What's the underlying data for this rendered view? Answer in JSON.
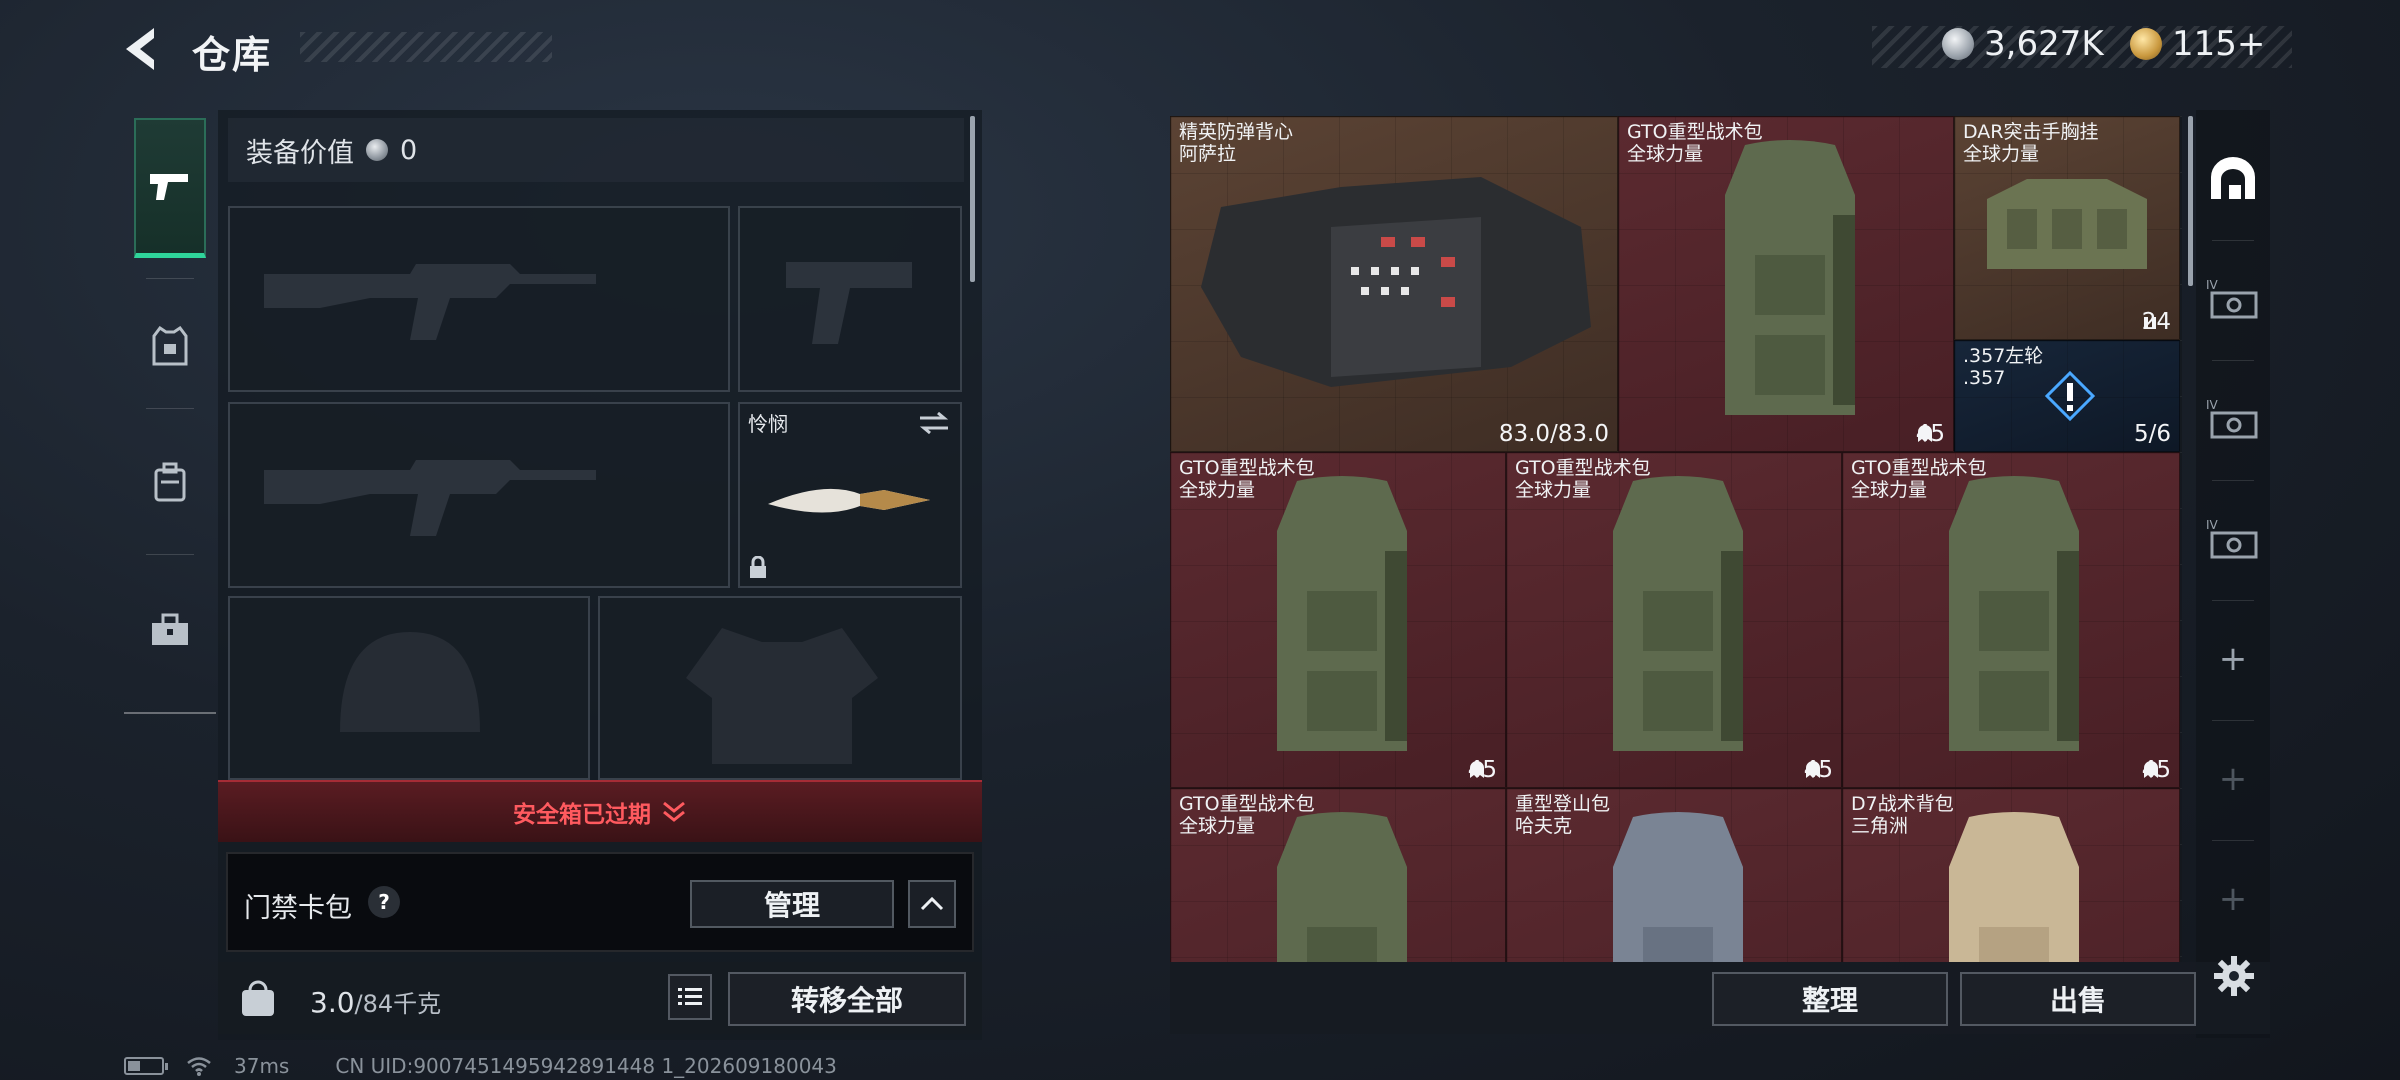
{
  "header": {
    "title": "仓库",
    "currency_silver": "3,627K",
    "currency_gold": "115+"
  },
  "left": {
    "value_label": "装备价值",
    "value_amount": "0",
    "melee_label": "怜悯",
    "expired_text": "安全箱已过期",
    "keycard_label": "门禁卡包",
    "help_label": "?",
    "manage_button": "管理",
    "weight_current": "3.0",
    "weight_max": "/84千克",
    "transfer_button": "转移全部"
  },
  "inventory": {
    "items": [
      {
        "name": "精英防弹背心",
        "sub": "阿萨拉",
        "stat": "83.0/83.0",
        "bg": "brown"
      },
      {
        "name": "GTO重型战术包",
        "sub": "全球力量",
        "stat": "45",
        "bg": "red"
      },
      {
        "name": "DAR突击手胸挂",
        "sub": "全球力量",
        "stat": "24",
        "bg": "brown"
      },
      {
        "name": ".357左轮",
        "sub": ".357",
        "stat": "5/6",
        "bg": "blue"
      },
      {
        "name": "GTO重型战术包",
        "sub": "全球力量",
        "stat": "45",
        "bg": "red"
      },
      {
        "name": "GTO重型战术包",
        "sub": "全球力量",
        "stat": "45",
        "bg": "red"
      },
      {
        "name": "GTO重型战术包",
        "sub": "全球力量",
        "stat": "45",
        "bg": "red"
      },
      {
        "name": "GTO重型战术包",
        "sub": "全球力量",
        "stat": "",
        "bg": "red"
      },
      {
        "name": "重型登山包",
        "sub": "哈夫克",
        "stat": "",
        "bg": "red"
      },
      {
        "name": "D7战术背包",
        "sub": "三角洲",
        "stat": "",
        "bg": "red"
      }
    ]
  },
  "bottom": {
    "sort_button": "整理",
    "sell_button": "出售"
  },
  "status": {
    "ping": "37ms",
    "uid": "CN UID:9007451495942891448 1_202609180043"
  }
}
